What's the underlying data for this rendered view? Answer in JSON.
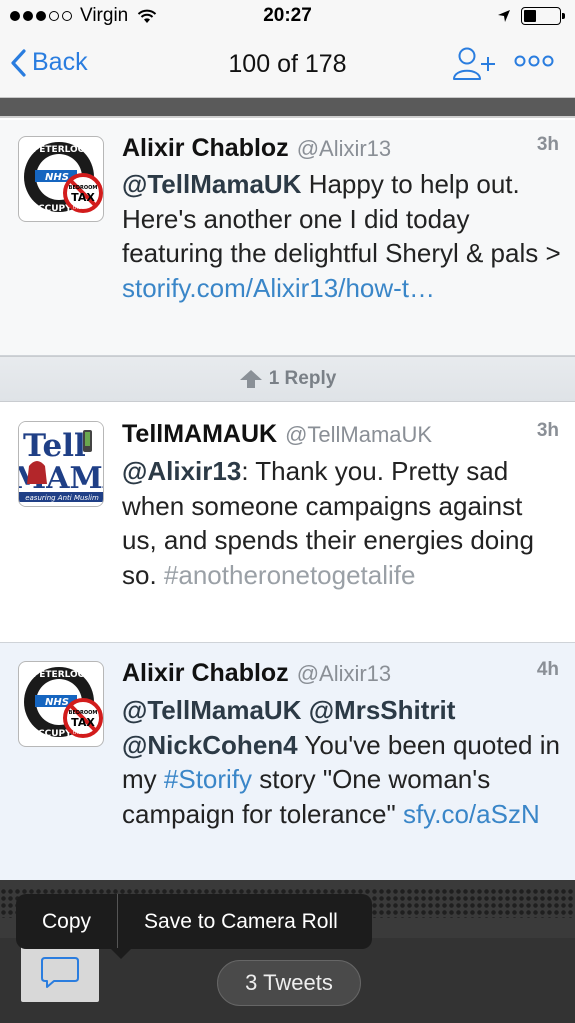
{
  "status": {
    "carrier": "Virgin",
    "time": "20:27"
  },
  "nav": {
    "back_label": "Back",
    "title": "100 of 178"
  },
  "tweets": [
    {
      "name": "Alixir Chabloz",
      "handle": "@Alixir13",
      "time": "3h",
      "text": {
        "mention1": "@TellMamaUK",
        "body": " Happy to help out. Here's another one I did today featuring the delightful Sheryl & pals > ",
        "link": "storify.com/Alixir13/how-t…"
      },
      "avatar": {
        "type": "peterloo",
        "top": "PETERLOO",
        "bottom": "OCCUPY",
        "mid": "NHS",
        "badge_top": "BEDROOM",
        "badge": "TAX",
        "the": "the"
      }
    },
    {
      "name": "TellMAMAUK",
      "handle": "@TellMamaUK",
      "time": "3h",
      "text": {
        "mention1": "@Alixir13",
        "body": ": Thank you. Pretty sad when someone campaigns against us, and spends their energies doing so. ",
        "hashtag": "#anotheronetogetalife"
      },
      "avatar": {
        "type": "tellmama",
        "line1": "Tell",
        "line2": "MAMA",
        "line3": "easuring Anti Muslim"
      }
    },
    {
      "name": "Alixir Chabloz",
      "handle": "@Alixir13",
      "time": "4h",
      "text": {
        "mention1": "@TellMamaUK",
        "mention2": "@MrsShitrit",
        "mention3": "@NickCohen4",
        "body1": " You've been quoted in my ",
        "hashtag": "#Storify",
        "body2": " story \"One woman's campaign for tolerance\" ",
        "link": "sfy.co/aSzN"
      },
      "avatar": {
        "type": "peterloo",
        "top": "PETERLOO",
        "bottom": "OCCUPY",
        "mid": "NHS",
        "badge_top": "BEDROOM",
        "badge": "TAX",
        "the": "the"
      }
    }
  ],
  "reply_bar": {
    "label": "1 Reply"
  },
  "menu": {
    "copy": "Copy",
    "save": "Save to Camera Roll"
  },
  "toolbar": {
    "tweets_count": "3 Tweets"
  },
  "colors": {
    "accent": "#2a7ddf",
    "link": "#3a86c8",
    "highlight_bg": "#eef3fa"
  }
}
